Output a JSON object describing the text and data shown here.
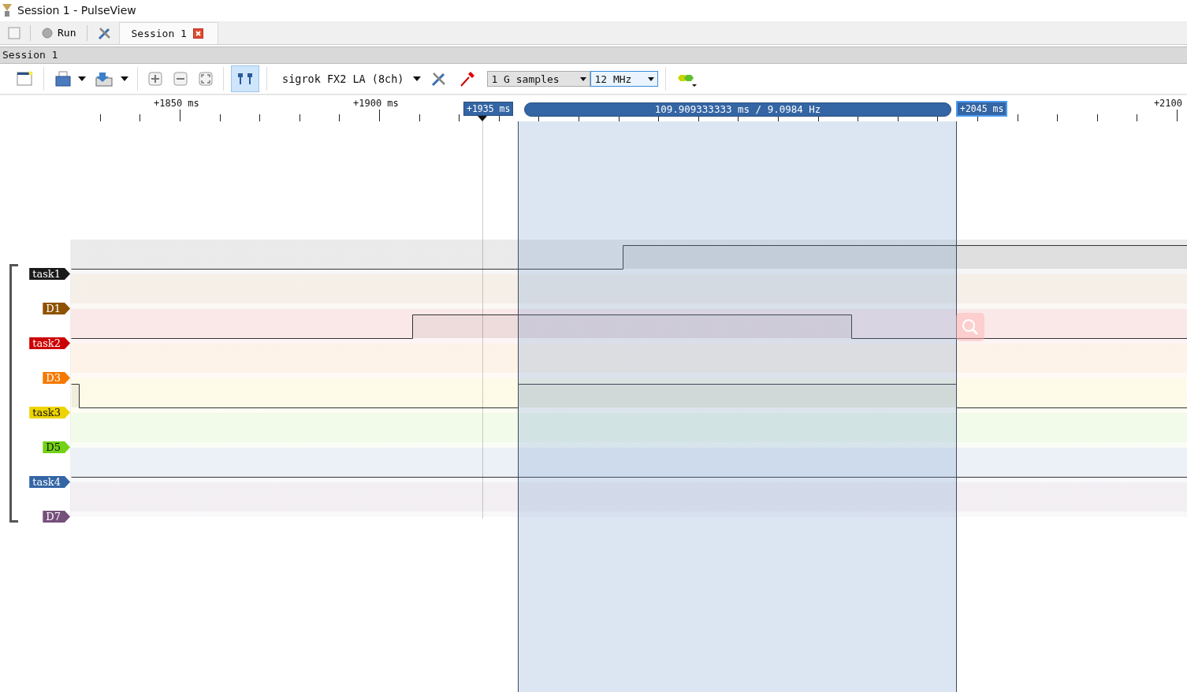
{
  "window": {
    "title": "Session 1 - PulseView"
  },
  "tabbar": {
    "run_button": "Run",
    "tabs": [
      {
        "label": "Session 1",
        "selected": true
      }
    ]
  },
  "session_label": "Session 1",
  "toolbar": {
    "cursor_toggle_on": true,
    "device": "sigrok FX2 LA (8ch)",
    "samples": "1 G samples",
    "samplerate": "12 MHz"
  },
  "ruler": {
    "ticks": [
      {
        "label": "+1850 ms",
        "kind": "full"
      },
      {
        "label": "+1900 ms",
        "kind": "full"
      },
      {
        "label": "+2100",
        "kind": "edge"
      }
    ]
  },
  "cursors": {
    "start": "+1935 ms",
    "end": "+2045 ms",
    "measurement": "109.909333333 ms / 9.0984 Hz"
  },
  "channels": [
    {
      "name": "task1",
      "color": "#1a1a1a"
    },
    {
      "name": "D1",
      "color": "#8f5200"
    },
    {
      "name": "task2",
      "color": "#cc0000"
    },
    {
      "name": "D3",
      "color": "#f57900"
    },
    {
      "name": "task3",
      "color": "#edd400"
    },
    {
      "name": "D5",
      "color": "#73d216"
    },
    {
      "name": "task4",
      "color": "#3465a4"
    },
    {
      "name": "D7",
      "color": "#75507b"
    }
  ]
}
